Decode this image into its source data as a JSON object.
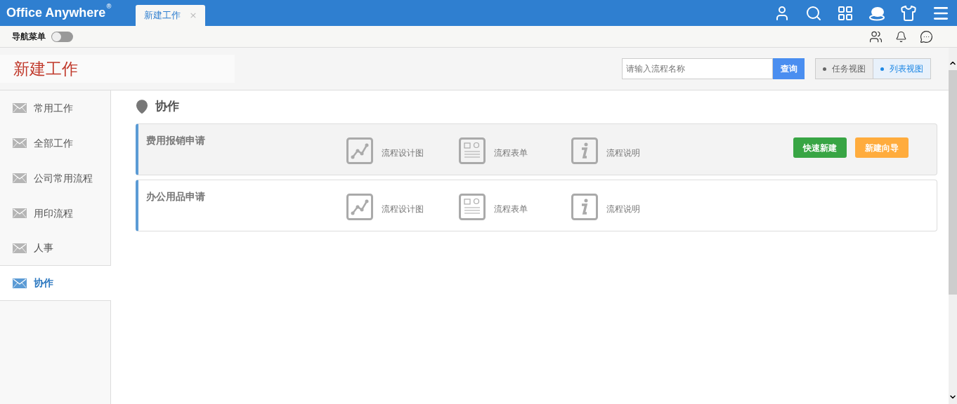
{
  "brand": {
    "name": "Office Anywhere",
    "mark": "®"
  },
  "tabs": [
    {
      "label": "新建工作",
      "close": "×",
      "selected": true
    }
  ],
  "nav_toggle": {
    "label": "导航菜单",
    "on": false
  },
  "page_title": "新建工作",
  "search": {
    "placeholder": "请输入流程名称",
    "button": "查询"
  },
  "views": [
    {
      "label": "任务视图",
      "selected": false
    },
    {
      "label": "列表视图",
      "selected": true
    }
  ],
  "sidebar": {
    "items": [
      {
        "label": "常用工作",
        "selected": false
      },
      {
        "label": "全部工作",
        "selected": false
      },
      {
        "label": "公司常用流程",
        "selected": false
      },
      {
        "label": "用印流程",
        "selected": false
      },
      {
        "label": "人事",
        "selected": false
      },
      {
        "label": "协作",
        "selected": true
      }
    ]
  },
  "section": {
    "title": "协作"
  },
  "flows": [
    {
      "name": "费用报销申请",
      "hovered": true,
      "links": [
        {
          "kind": "chart",
          "label": "流程设计图"
        },
        {
          "kind": "form",
          "label": "流程表单"
        },
        {
          "kind": "info",
          "label": "流程说明"
        }
      ],
      "actions": [
        {
          "label": "快速新建",
          "color": "#38a544"
        },
        {
          "label": "新建向导",
          "color": "#ffac3d"
        }
      ]
    },
    {
      "name": "办公用品申请",
      "hovered": false,
      "links": [
        {
          "kind": "chart",
          "label": "流程设计图"
        },
        {
          "kind": "form",
          "label": "流程表单"
        },
        {
          "kind": "info",
          "label": "流程说明"
        }
      ]
    }
  ]
}
